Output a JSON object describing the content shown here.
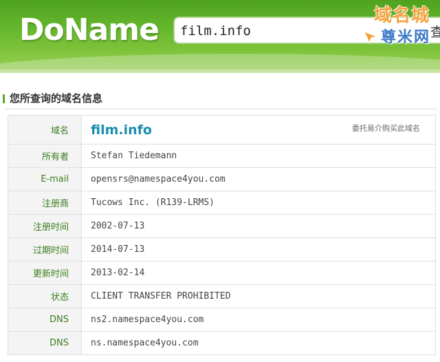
{
  "header": {
    "logo": "DoName",
    "search_value": "film.info",
    "search_button": "查",
    "watermark_top": "域名城",
    "watermark_bottom": "尊米网"
  },
  "section": {
    "title": "您所查询的域名信息"
  },
  "whois": {
    "domain_label": "域名",
    "domain_value": "film.info",
    "broker_link": "委托易介购买此域名",
    "rows": [
      {
        "label": "所有者",
        "value": "Stefan Tiedemann"
      },
      {
        "label": "E-mail",
        "value": "opensrs@namespace4you.com"
      },
      {
        "label": "注册商",
        "value": "Tucows Inc. (R139-LRMS)"
      },
      {
        "label": "注册时间",
        "value": "2002-07-13"
      },
      {
        "label": "过期时间",
        "value": "2014-07-13"
      },
      {
        "label": "更新时间",
        "value": "2013-02-14"
      },
      {
        "label": "状态",
        "value": "CLIENT TRANSFER PROHIBITED"
      },
      {
        "label": "DNS",
        "value": "ns2.namespace4you.com"
      },
      {
        "label": "DNS",
        "value": "ns.namespace4you.com"
      }
    ]
  },
  "colors": {
    "header_green": "#62b52b",
    "label_green": "#3a7d1e",
    "domain_blue": "#1a8cb0",
    "email_navy": "#1a2a8a"
  }
}
